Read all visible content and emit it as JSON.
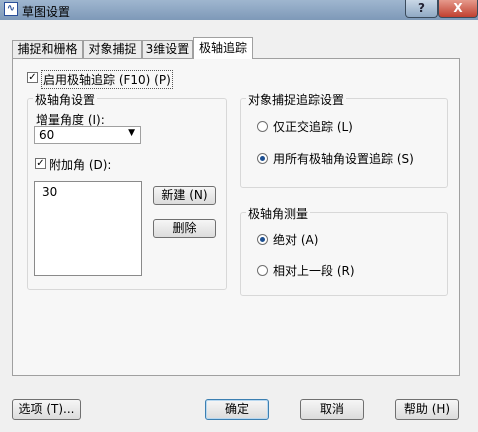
{
  "window": {
    "title": "草图设置",
    "app_icon": "autocad-icon",
    "help_button": "?",
    "close_button": "X"
  },
  "tabs": [
    {
      "label": "捕捉和栅格",
      "active": false
    },
    {
      "label": "对象捕捉",
      "active": false
    },
    {
      "label": "3维设置",
      "active": false
    },
    {
      "label": "极轴追踪",
      "active": true
    }
  ],
  "polar": {
    "enable_label": "启用极轴追踪 (F10) (P)",
    "enable_checked": true,
    "angle_group_title": "极轴角设置",
    "increment_label": "增量角度 (I):",
    "increment_value": "60",
    "additional_label": "附加角 (D):",
    "additional_checked": true,
    "additional_angles": [
      "30"
    ],
    "new_button": "新建 (N)",
    "delete_button": "删除"
  },
  "osnap_tracking": {
    "title": "对象捕捉追踪设置",
    "options": [
      {
        "label": "仅正交追踪 (L)",
        "selected": false
      },
      {
        "label": "用所有极轴角设置追踪 (S)",
        "selected": true
      }
    ]
  },
  "polar_measurement": {
    "title": "极轴角测量",
    "options": [
      {
        "label": "绝对 (A)",
        "selected": true
      },
      {
        "label": "相对上一段 (R)",
        "selected": false
      }
    ]
  },
  "footer": {
    "options_button": "选项 (T)...",
    "ok_button": "确定",
    "cancel_button": "取消",
    "help_button": "帮助 (H)"
  }
}
